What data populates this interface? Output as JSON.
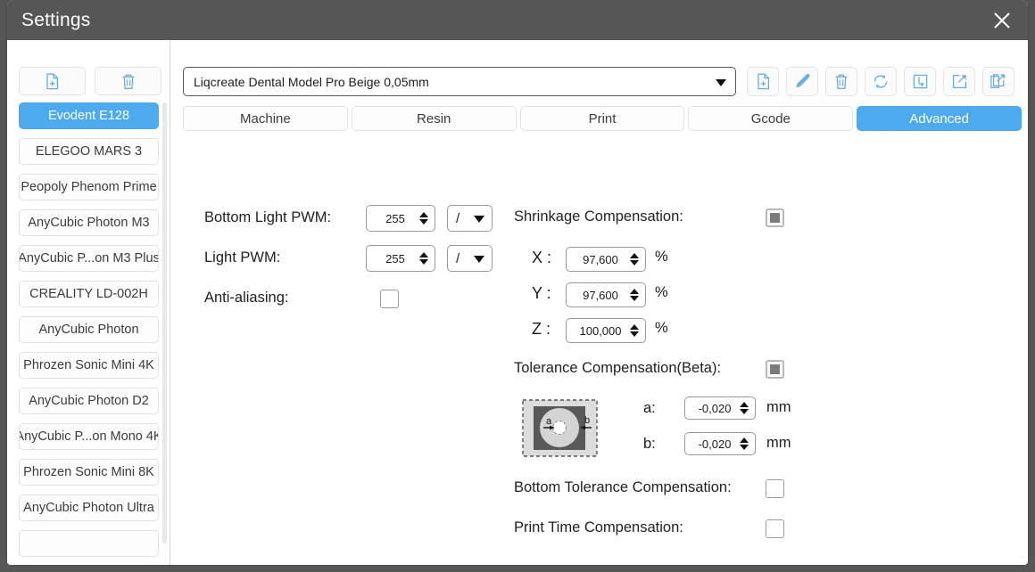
{
  "window": {
    "title": "Settings",
    "close_icon": "close-x-icon"
  },
  "sidebar": {
    "toolbar": [
      {
        "name": "add-printer-button",
        "icon": "file-plus-icon"
      },
      {
        "name": "delete-printer-button",
        "icon": "trash-icon"
      }
    ],
    "printers": [
      {
        "label": "Evodent E128",
        "selected": true
      },
      {
        "label": "ELEGOO MARS 3",
        "selected": false
      },
      {
        "label": "Peopoly Phenom Prime",
        "selected": false
      },
      {
        "label": "AnyCubic Photon M3",
        "selected": false
      },
      {
        "label": "AnyCubic P...on M3 Plus",
        "selected": false
      },
      {
        "label": "CREALITY LD-002H",
        "selected": false
      },
      {
        "label": "AnyCubic Photon",
        "selected": false
      },
      {
        "label": "Phrozen Sonic Mini 4K",
        "selected": false
      },
      {
        "label": "AnyCubic Photon D2",
        "selected": false
      },
      {
        "label": "AnyCubic P...on Mono 4K",
        "selected": false
      },
      {
        "label": "Phrozen Sonic Mini 8K",
        "selected": false
      },
      {
        "label": "AnyCubic Photon Ultra",
        "selected": false
      },
      {
        "label": "",
        "selected": false
      }
    ]
  },
  "main": {
    "profile": {
      "value": "Liqcreate Dental Model Pro Beige 0,05mm",
      "caret_icon": "chevron-down-icon",
      "tools": [
        {
          "name": "new-profile-button",
          "icon": "file-plus-icon"
        },
        {
          "name": "edit-profile-button",
          "icon": "pencil-icon"
        },
        {
          "name": "delete-profile-button",
          "icon": "trash-icon"
        },
        {
          "name": "reset-profile-button",
          "icon": "refresh-icon"
        },
        {
          "name": "import-profile-button",
          "icon": "import-arrow-icon"
        },
        {
          "name": "export-profile-button",
          "icon": "export-arrow-icon"
        },
        {
          "name": "share-profile-button",
          "icon": "share-copy-icon"
        }
      ]
    },
    "tabs": [
      {
        "label": "Machine",
        "active": false
      },
      {
        "label": "Resin",
        "active": false
      },
      {
        "label": "Print",
        "active": false
      },
      {
        "label": "Gcode",
        "active": false
      },
      {
        "label": "Advanced",
        "active": true
      }
    ],
    "advanced": {
      "bottom_light_pwm": {
        "label": "Bottom Light PWM:",
        "value": "255",
        "mode": "/"
      },
      "light_pwm": {
        "label": "Light PWM:",
        "value": "255",
        "mode": "/"
      },
      "anti_aliasing": {
        "label": "Anti-aliasing:",
        "checked": false
      },
      "shrinkage": {
        "label": "Shrinkage Compensation:",
        "checked": true,
        "x": {
          "label": "X :",
          "value": "97,600",
          "unit": "%"
        },
        "y": {
          "label": "Y :",
          "value": "97,600",
          "unit": "%"
        },
        "z": {
          "label": "Z :",
          "value": "100,000",
          "unit": "%"
        }
      },
      "tolerance": {
        "label": "Tolerance Compensation(Beta):",
        "checked": true,
        "diagram_icon": "tolerance-ab-diagram-icon",
        "diagram_labels": {
          "a": "a",
          "b": "b"
        },
        "a": {
          "label": "a:",
          "value": "-0,020",
          "unit": "mm"
        },
        "b": {
          "label": "b:",
          "value": "-0,020",
          "unit": "mm"
        }
      },
      "bottom_tolerance": {
        "label": "Bottom Tolerance Compensation:",
        "checked": false
      },
      "print_time": {
        "label": "Print Time Compensation:",
        "checked": false
      }
    }
  },
  "colors": {
    "accent": "#4daaee",
    "titlebar": "#565656",
    "icon_blue": "#6aaee0"
  }
}
